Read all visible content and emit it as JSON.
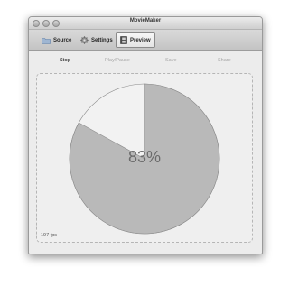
{
  "window": {
    "title": "MovieMaker"
  },
  "toolbar": {
    "items": [
      {
        "label": "Source",
        "icon": "folder-icon"
      },
      {
        "label": "Settings",
        "icon": "gear-icon"
      },
      {
        "label": "Preview",
        "icon": "film-icon",
        "active": true
      }
    ]
  },
  "controls": {
    "stop": "Stop",
    "play_pause": "Play/Pause",
    "save": "Save",
    "share": "Share"
  },
  "progress": {
    "percent": 83,
    "label": "83%",
    "fill_color": "#b9b9b9",
    "remaining_color": "#f2f2f2"
  },
  "status": {
    "fps": "197 fps"
  }
}
